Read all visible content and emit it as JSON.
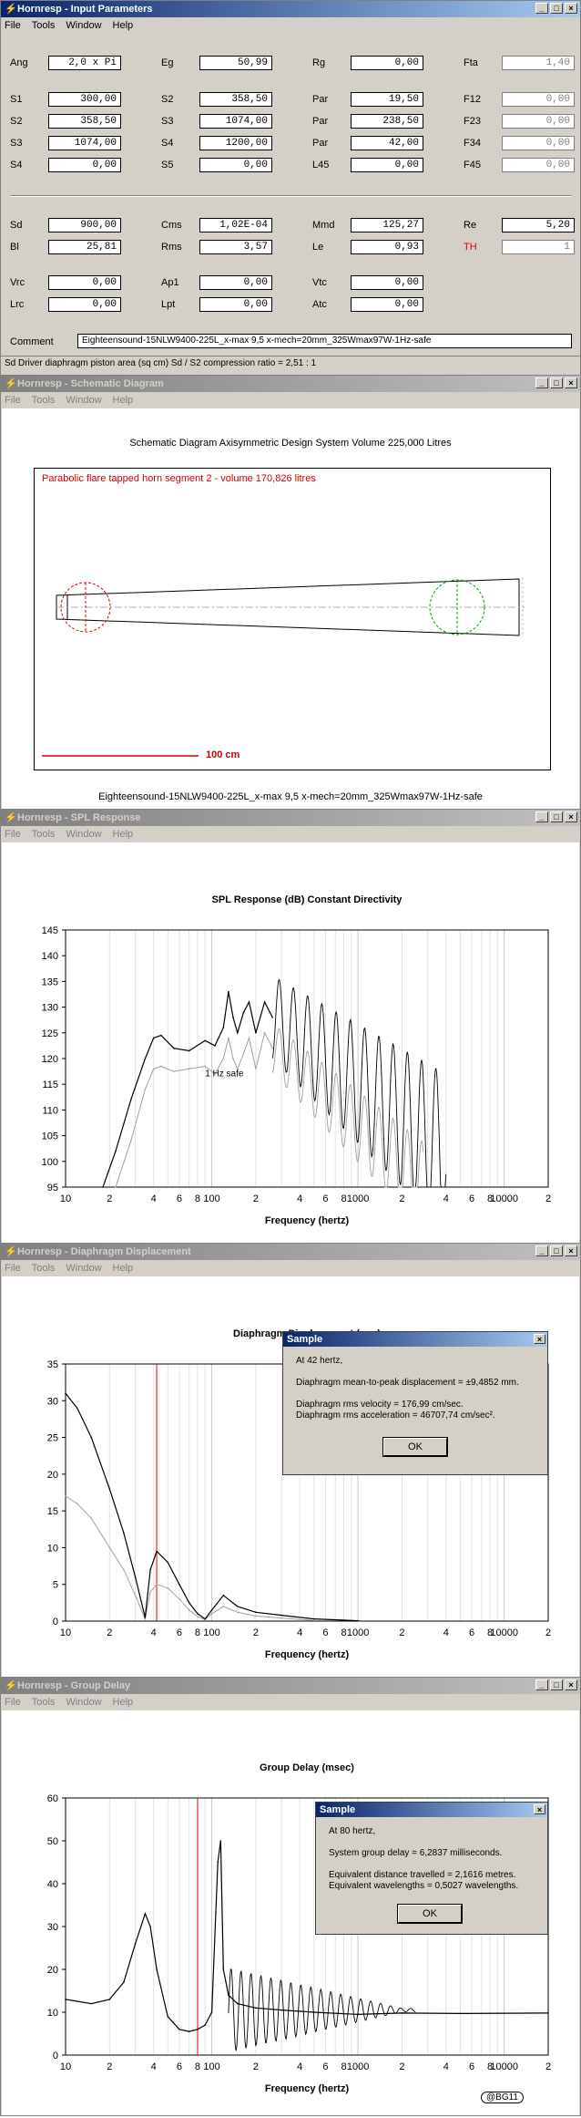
{
  "input_window": {
    "title": "Hornresp - Input Parameters",
    "menu": [
      "File",
      "Tools",
      "Window",
      "Help"
    ],
    "row1": [
      {
        "label": "Ang",
        "value": "2,0 x Pi",
        "disabled": false
      },
      {
        "label": "Eg",
        "value": "50,99",
        "disabled": false
      },
      {
        "label": "Rg",
        "value": "0,00",
        "disabled": false
      },
      {
        "label": "Fta",
        "value": "1,40",
        "disabled": true
      }
    ],
    "grid": [
      [
        {
          "label": "S1",
          "value": "300,00"
        },
        {
          "label": "S2",
          "value": "358,50"
        },
        {
          "label": "Par",
          "value": "19,50"
        },
        {
          "label": "F12",
          "value": "0,00",
          "disabled": true
        }
      ],
      [
        {
          "label": "S2",
          "value": "358,50"
        },
        {
          "label": "S3",
          "value": "1074,00"
        },
        {
          "label": "Par",
          "value": "238,50"
        },
        {
          "label": "F23",
          "value": "0,00",
          "disabled": true
        }
      ],
      [
        {
          "label": "S3",
          "value": "1074,00"
        },
        {
          "label": "S4",
          "value": "1200,00"
        },
        {
          "label": "Par",
          "value": "42,00"
        },
        {
          "label": "F34",
          "value": "0,00",
          "disabled": true
        }
      ],
      [
        {
          "label": "S4",
          "value": "0,00"
        },
        {
          "label": "S5",
          "value": "0,00"
        },
        {
          "label": "L45",
          "value": "0,00"
        },
        {
          "label": "F45",
          "value": "0,00",
          "disabled": true
        }
      ]
    ],
    "driver": [
      [
        {
          "label": "Sd",
          "value": "900,00"
        },
        {
          "label": "Cms",
          "value": "1,02E-04"
        },
        {
          "label": "Mmd",
          "value": "125,27"
        },
        {
          "label": "Re",
          "value": "5,20"
        }
      ],
      [
        {
          "label": "Bl",
          "value": "25,81"
        },
        {
          "label": "Rms",
          "value": "3,57"
        },
        {
          "label": "Le",
          "value": "0,93"
        },
        {
          "label": "TH",
          "value": "1",
          "disabled": true,
          "red": true
        }
      ]
    ],
    "chambers": [
      [
        {
          "label": "Vrc",
          "value": "0,00"
        },
        {
          "label": "Ap1",
          "value": "0,00"
        },
        {
          "label": "Vtc",
          "value": "0,00"
        }
      ],
      [
        {
          "label": "Lrc",
          "value": "0,00"
        },
        {
          "label": "Lpt",
          "value": "0,00"
        },
        {
          "label": "Atc",
          "value": "0,00"
        }
      ]
    ],
    "comment_label": "Comment",
    "comment": "Eighteensound-15NLW9400-225L_x-max 9,5 x-mech=20mm_325Wmax97W-1Hz-safe",
    "status": "Sd   Driver diaphragm piston area  (sq cm)    Sd / S2 compression ratio = 2,51 : 1"
  },
  "schematic_window": {
    "title": "Hornresp - Schematic Diagram",
    "menu": [
      "File",
      "Tools",
      "Window",
      "Help"
    ],
    "heading": "Schematic Diagram    Axisymmetric Design    System Volume 225,000 Litres",
    "segment_label": "Parabolic flare tapped horn segment 2 - volume 170,826 litres",
    "scale_label": "100 cm",
    "footer": "Eighteensound-15NLW9400-225L_x-max 9,5 x-mech=20mm_325Wmax97W-1Hz-safe"
  },
  "spl_window": {
    "title": "Hornresp - SPL Response",
    "menu": [
      "File",
      "Tools",
      "Window",
      "Help"
    ],
    "chart_data": {
      "type": "line",
      "title": "SPL Response (dB)    Constant Directivity",
      "xlabel": "Frequency (hertz)",
      "ylabel": "",
      "x_scale": "log",
      "xlim": [
        10,
        20000
      ],
      "ylim": [
        95,
        145
      ],
      "x_ticks": [
        "10",
        "2",
        "4",
        "6",
        "8",
        "100",
        "2",
        "4",
        "6",
        "8",
        "1000",
        "2",
        "4",
        "6",
        "8",
        "10000",
        "2"
      ],
      "y_ticks": [
        95,
        100,
        105,
        110,
        115,
        120,
        125,
        130,
        135,
        140,
        145
      ],
      "annotation": "1 Hz safe",
      "series": [
        {
          "color": "#000000",
          "x": [
            18,
            22,
            28,
            35,
            40,
            45,
            55,
            70,
            90,
            105,
            120,
            130,
            140,
            150,
            165,
            180,
            200,
            230,
            260
          ],
          "y": [
            95,
            102,
            112,
            120,
            124,
            124.5,
            122,
            121.5,
            123.5,
            122.5,
            126,
            133,
            128,
            125,
            129,
            131,
            125,
            131,
            128
          ]
        },
        {
          "color": "#a0a0a0",
          "x": [
            22,
            28,
            35,
            40,
            45,
            55,
            70,
            90,
            105,
            120,
            130,
            140,
            150,
            165,
            180,
            200,
            230,
            260
          ],
          "y": [
            95,
            104,
            114,
            118,
            118.5,
            117.5,
            118,
            118.5,
            117,
            120,
            124,
            120,
            118,
            121,
            124,
            118,
            125,
            122
          ]
        }
      ]
    }
  },
  "displacement_window": {
    "title": "Hornresp - Diaphragm Displacement",
    "menu": [
      "File",
      "Tools",
      "Window",
      "Help"
    ],
    "chart_data": {
      "type": "line",
      "title": "Diaphragm Displacement (mm)",
      "xlabel": "Frequency (hertz)",
      "ylabel": "",
      "x_scale": "log",
      "xlim": [
        10,
        20000
      ],
      "ylim": [
        0,
        35
      ],
      "x_ticks": [
        "10",
        "2",
        "4",
        "6",
        "8",
        "100",
        "2",
        "4",
        "6",
        "8",
        "1000",
        "2",
        "4",
        "6",
        "8",
        "10000",
        "2"
      ],
      "y_ticks": [
        0,
        5,
        10,
        15,
        20,
        25,
        30,
        35
      ],
      "marker_x": 42,
      "series": [
        {
          "color": "#000000",
          "x": [
            10,
            12,
            15,
            20,
            25,
            30,
            35,
            38,
            42,
            50,
            60,
            70,
            80,
            90,
            100,
            120,
            150,
            200,
            300,
            500,
            1000
          ],
          "y": [
            31,
            29,
            25,
            18,
            12,
            6,
            0.5,
            7,
            9.5,
            8,
            5,
            2.5,
            1,
            0.3,
            1.5,
            3.5,
            2,
            1.2,
            0.8,
            0.3,
            0.05
          ]
        },
        {
          "color": "#a0a0a0",
          "x": [
            10,
            12,
            15,
            20,
            25,
            30,
            35,
            38,
            42,
            50,
            60,
            70,
            80,
            90,
            100,
            120,
            150,
            200,
            300,
            500
          ],
          "y": [
            17,
            16,
            14,
            10,
            7,
            3.5,
            0.3,
            4,
            5,
            4.5,
            3,
            1.5,
            0.6,
            0.2,
            1,
            2,
            1.2,
            0.7,
            0.4,
            0.1
          ]
        }
      ]
    },
    "dialog": {
      "title": "Sample",
      "lines": [
        "At 42 hertz,",
        "Diaphragm mean-to-peak displacement = ±9,4852 mm.",
        "Diaphragm rms velocity = 176,99 cm/sec.",
        "Diaphragm rms acceleration = 46707,74 cm/sec²."
      ],
      "ok": "OK"
    }
  },
  "group_delay_window": {
    "title": "Hornresp - Group Delay",
    "menu": [
      "File",
      "Tools",
      "Window",
      "Help"
    ],
    "chart_data": {
      "type": "line",
      "title": "Group Delay (msec)",
      "xlabel": "Frequency (hertz)",
      "ylabel": "",
      "x_scale": "log",
      "xlim": [
        10,
        20000
      ],
      "ylim": [
        0,
        60
      ],
      "x_ticks": [
        "10",
        "2",
        "4",
        "6",
        "8",
        "100",
        "2",
        "4",
        "6",
        "8",
        "1000",
        "2",
        "4",
        "6",
        "8",
        "10000",
        "2"
      ],
      "y_ticks": [
        0,
        10,
        20,
        30,
        40,
        50,
        60
      ],
      "marker_x": 80,
      "series": [
        {
          "color": "#000000",
          "x": [
            10,
            15,
            20,
            25,
            30,
            35,
            38,
            42,
            50,
            60,
            70,
            80,
            90,
            100,
            110,
            115,
            120,
            130,
            150,
            200,
            300,
            500,
            1000,
            2000,
            5000,
            20000
          ],
          "y": [
            13,
            12,
            13,
            17,
            26,
            33,
            30,
            20,
            9,
            6,
            5.5,
            6,
            7,
            10,
            45,
            50,
            20,
            14,
            12,
            11,
            10.5,
            10,
            9.5,
            9.8,
            9.7,
            9.8
          ]
        }
      ]
    },
    "dialog": {
      "title": "Sample",
      "lines": [
        "At 80 hertz,",
        "System group delay = 6,2837 milliseconds.",
        "Equivalent distance travelled = 2,1616 metres.",
        "Equivalent wavelengths = 0,5027 wavelengths."
      ],
      "ok": "OK"
    },
    "badge": "@BG11"
  },
  "icons": {
    "window": "hornresp-icon",
    "min": "minimize-icon",
    "max": "maximize-icon",
    "close": "close-icon"
  }
}
